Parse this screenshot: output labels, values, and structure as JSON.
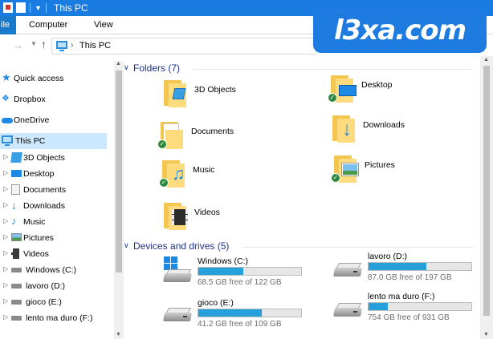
{
  "window": {
    "title": "This PC"
  },
  "ribbon": {
    "tabs": [
      "ile",
      "Computer",
      "View"
    ]
  },
  "address": {
    "path": "This PC"
  },
  "nav": {
    "items": [
      {
        "label": "Quick access",
        "icon": "star-icon"
      },
      {
        "label": "Dropbox",
        "icon": "dropbox-icon"
      },
      {
        "label": "OneDrive",
        "icon": "cloud-icon"
      },
      {
        "label": "This PC",
        "icon": "pc-icon",
        "selected": true
      },
      {
        "label": "3D Objects",
        "icon": "cube-icon"
      },
      {
        "label": "Desktop",
        "icon": "desktop-icon"
      },
      {
        "label": "Documents",
        "icon": "documents-icon"
      },
      {
        "label": "Downloads",
        "icon": "download-icon"
      },
      {
        "label": "Music",
        "icon": "music-icon"
      },
      {
        "label": "Pictures",
        "icon": "pictures-icon"
      },
      {
        "label": "Videos",
        "icon": "videos-icon"
      },
      {
        "label": "Windows (C:)",
        "icon": "drive-icon"
      },
      {
        "label": "lavoro (D:)",
        "icon": "drive-icon"
      },
      {
        "label": "gioco (E:)",
        "icon": "drive-icon"
      },
      {
        "label": "lento ma duro (F:)",
        "icon": "drive-icon"
      }
    ]
  },
  "folders": {
    "header": "Folders (7)",
    "items": [
      {
        "name": "3D Objects",
        "synced": false
      },
      {
        "name": "Desktop",
        "synced": true
      },
      {
        "name": "Documents",
        "synced": true
      },
      {
        "name": "Downloads",
        "synced": false
      },
      {
        "name": "Music",
        "synced": true
      },
      {
        "name": "Pictures",
        "synced": true
      },
      {
        "name": "Videos",
        "synced": false
      }
    ]
  },
  "drives": {
    "header": "Devices and drives (5)",
    "items": [
      {
        "name": "Windows (C:)",
        "free": "68.5 GB free of 122 GB",
        "used_fraction": 0.44
      },
      {
        "name": "lavoro (D:)",
        "free": "87.0 GB free of 197 GB",
        "used_fraction": 0.56
      },
      {
        "name": "gioco (E:)",
        "free": "41.2 GB free of 109 GB",
        "used_fraction": 0.62
      },
      {
        "name": "lento ma duro (F:)",
        "free": "754 GB free of 931 GB",
        "used_fraction": 0.19
      }
    ]
  },
  "watermark": {
    "text": "l3xa.com"
  },
  "colors": {
    "titlebar": "#1a7be0",
    "selection": "#cce8ff",
    "progress": "#26a0da",
    "header_text": "#1e3287"
  }
}
